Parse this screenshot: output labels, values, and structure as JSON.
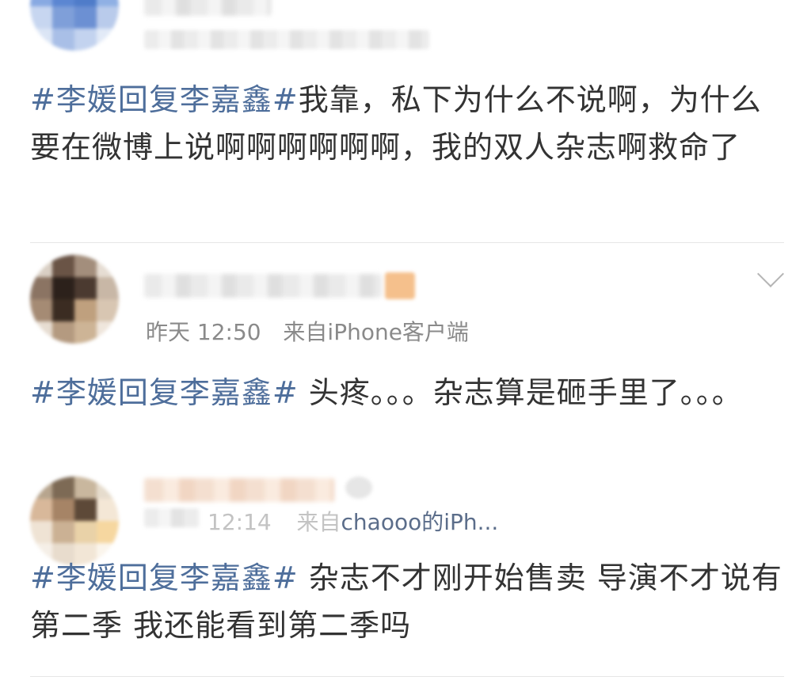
{
  "posts": [
    {
      "author_obscured": "kimwin",
      "source_obscured": "droiu",
      "topic": "#李媛回复李嘉鑫#",
      "text": "我靠，私下为什么不说啊，为什么要在微博上说啊啊啊啊啊啊，我的双人杂志啊救命了"
    },
    {
      "time": "昨天 12:50",
      "source_prefix": "来自",
      "source": "iPhone客户端",
      "topic": "#李媛回复李嘉鑫#",
      "text": " 头疼。。。杂志算是砸手里了。。。"
    },
    {
      "time": "12:14",
      "source_prefix": "来自",
      "source": "chaooo的iPh...",
      "topic": "#李媛回复李嘉鑫#",
      "text": " 杂志不才刚开始售卖 导演不才说有第二季 我还能看到第二季吗"
    }
  ],
  "colors": {
    "topic": "#4e6e9b",
    "text": "#333333",
    "meta": "#8a8a8a",
    "divider": "#e6e6e6"
  }
}
